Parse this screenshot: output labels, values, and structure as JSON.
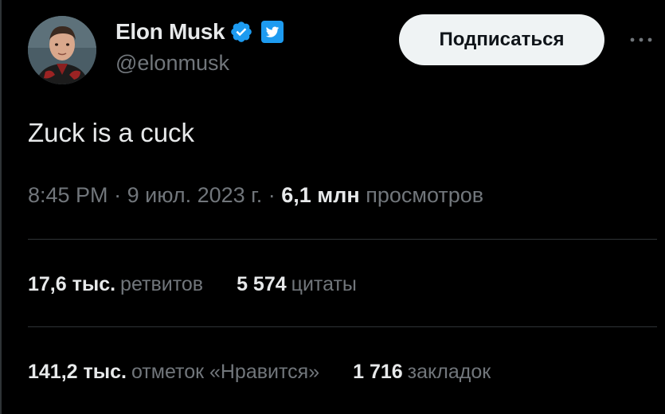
{
  "tweet": {
    "author": {
      "display_name": "Elon Musk",
      "handle": "@elonmusk",
      "verified_badge": "verified-badge-icon",
      "affiliate_badge": "twitter-logo-icon"
    },
    "follow_label": "Подписаться",
    "more_icon": "more-dots-icon",
    "text": "Zuck is a cuck",
    "meta": {
      "time": "8:45 PM",
      "separator": "·",
      "date": "9 июл. 2023 г.",
      "views_count": "6,1 млн",
      "views_label": "просмотров"
    },
    "stats_row_1": [
      {
        "count": "17,6 тыс.",
        "label": "ретвитов"
      },
      {
        "count": "5 574",
        "label": "цитаты"
      }
    ],
    "stats_row_2": [
      {
        "count": "141,2 тыс.",
        "label": "отметок «Нравится»"
      },
      {
        "count": "1 716",
        "label": "закладок"
      }
    ]
  },
  "colors": {
    "background": "#000000",
    "primary_text": "#e7e9ea",
    "secondary_text": "#71767b",
    "divider": "#2f3336",
    "verified_blue": "#1d9bf0",
    "follow_bg": "#eff3f4"
  }
}
